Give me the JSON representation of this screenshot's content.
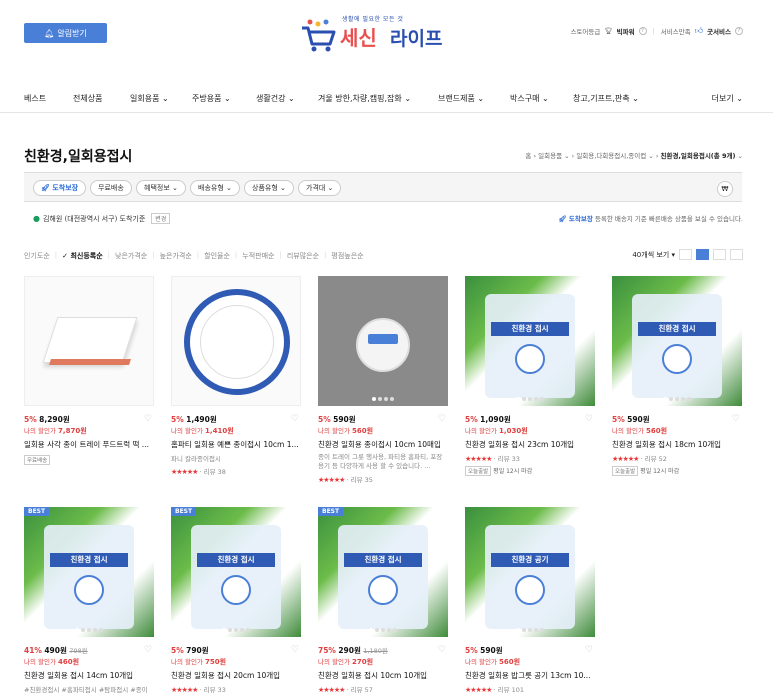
{
  "header": {
    "notify_label": "알림받기",
    "logo_tagline": "생활에 필요한 모든 것",
    "logo_name_1": "세신",
    "logo_name_2": "라이프",
    "store_grade_label": "스토어등급",
    "store_grade_value": "빅파워",
    "service_label": "서비스만족",
    "service_value": "굿서비스"
  },
  "nav": {
    "items": [
      "베스트",
      "전체상품",
      "일회용품",
      "주방용품",
      "생활건강",
      "겨울 방한,차량,캠핑,잡화",
      "브랜드제품",
      "박스구매",
      "창고,기프트,판촉"
    ],
    "more": "더보기"
  },
  "page": {
    "title": "친환경,일회용접시",
    "breadcrumb": [
      "홈",
      "일회용품",
      "일회용,다회용접시,종이컵",
      "친환경,일회용접시(총 9개)"
    ]
  },
  "filters": {
    "chips": [
      "도착보장",
      "무료배송",
      "혜택정보",
      "배송유형",
      "상품유형",
      "가격대"
    ],
    "currency": "₩"
  },
  "location": {
    "text": "김해원 (대전광역시 서구) 도착기준",
    "change": "변경",
    "rocket_label": "도착보장",
    "rocket_note": "등록한 배송지 기준 빠른배송 상품을 보실 수 있습니다."
  },
  "sort": {
    "options": [
      "인기도순",
      "최신등록순",
      "낮은가격순",
      "높은가격순",
      "할인율순",
      "누적판매순",
      "리뷰많은순",
      "평점높은순"
    ],
    "active": "최신등록순",
    "per_page": "40개씩 보기"
  },
  "products": [
    {
      "discount": "5%",
      "price": "8,290원",
      "old": "",
      "my_label": "나의 할인가",
      "my_price": "7,870원",
      "name": "일회용 사각 종이 트레이 푸드트럭 떡 ...",
      "sub": "",
      "stars": "",
      "review": "",
      "badge": "무료배송",
      "ship": "",
      "best": ""
    },
    {
      "discount": "5%",
      "price": "1,490원",
      "old": "",
      "my_label": "나의 할인가",
      "my_price": "1,410원",
      "name": "홈파티 일회용 예쁜 종이접시 10cm 1...",
      "sub": "파니 칼라종이접시",
      "stars": "★★★★★",
      "review": "리뷰 38",
      "badge": "",
      "ship": "",
      "best": ""
    },
    {
      "discount": "5%",
      "price": "590원",
      "old": "",
      "my_label": "나의 할인가",
      "my_price": "560원",
      "name": "친환경 일회용 종이접시 10cm 10매입",
      "sub": "종이 트레이 그릇 행사용, 파티용 홈파티, 포장용기 등 다양하게 사용 할 수 있습니다. ...",
      "stars": "★★★★★",
      "review": "리뷰 35",
      "badge": "",
      "ship": "",
      "best": ""
    },
    {
      "discount": "5%",
      "price": "1,090원",
      "old": "",
      "my_label": "나의 할인가",
      "my_price": "1,030원",
      "name": "친환경 일회용 접시 23cm 10개입",
      "sub": "",
      "stars": "★★★★★",
      "review": "리뷰 33",
      "badge": "오늘출발",
      "ship": "평일 12시 마감",
      "best": ""
    },
    {
      "discount": "5%",
      "price": "590원",
      "old": "",
      "my_label": "나의 할인가",
      "my_price": "560원",
      "name": "친환경 일회용 접시 18cm 10개입",
      "sub": "",
      "stars": "★★★★★",
      "review": "리뷰 52",
      "badge": "오늘출발",
      "ship": "평일 12시 마감",
      "best": ""
    },
    {
      "discount": "41%",
      "price": "490원",
      "old": "798원",
      "my_label": "나의 할인가",
      "my_price": "460원",
      "name": "친환경 일회용 접시 14cm 10개입",
      "sub": "#친환경접시 #홈파티접시 #탐파접시 #종이",
      "stars": "",
      "review": "",
      "badge": "",
      "ship": "",
      "best": "BEST"
    },
    {
      "discount": "5%",
      "price": "790원",
      "old": "",
      "my_label": "나의 할인가",
      "my_price": "750원",
      "name": "친환경 일회용 접시 20cm 10개입",
      "sub": "",
      "stars": "★★★★★",
      "review": "리뷰 33",
      "badge": "",
      "ship": "",
      "best": "BEST"
    },
    {
      "discount": "75%",
      "price": "290원",
      "old": "1,180원",
      "my_label": "나의 할인가",
      "my_price": "270원",
      "name": "친환경 일회용 접시 10cm 10개입",
      "sub": "",
      "stars": "★★★★★",
      "review": "리뷰 57",
      "badge": "",
      "ship": "",
      "best": "BEST"
    },
    {
      "discount": "5%",
      "price": "590원",
      "old": "",
      "my_label": "나의 할인가",
      "my_price": "560원",
      "name": "친환경 일회용 밥그릇 공기 13cm 10...",
      "sub": "",
      "stars": "★★★★★",
      "review": "리뷰 101",
      "badge": "",
      "ship": "",
      "best": ""
    }
  ],
  "pkg_text": {
    "plate": "친환경 접시",
    "bowl": "친환경 공기"
  }
}
